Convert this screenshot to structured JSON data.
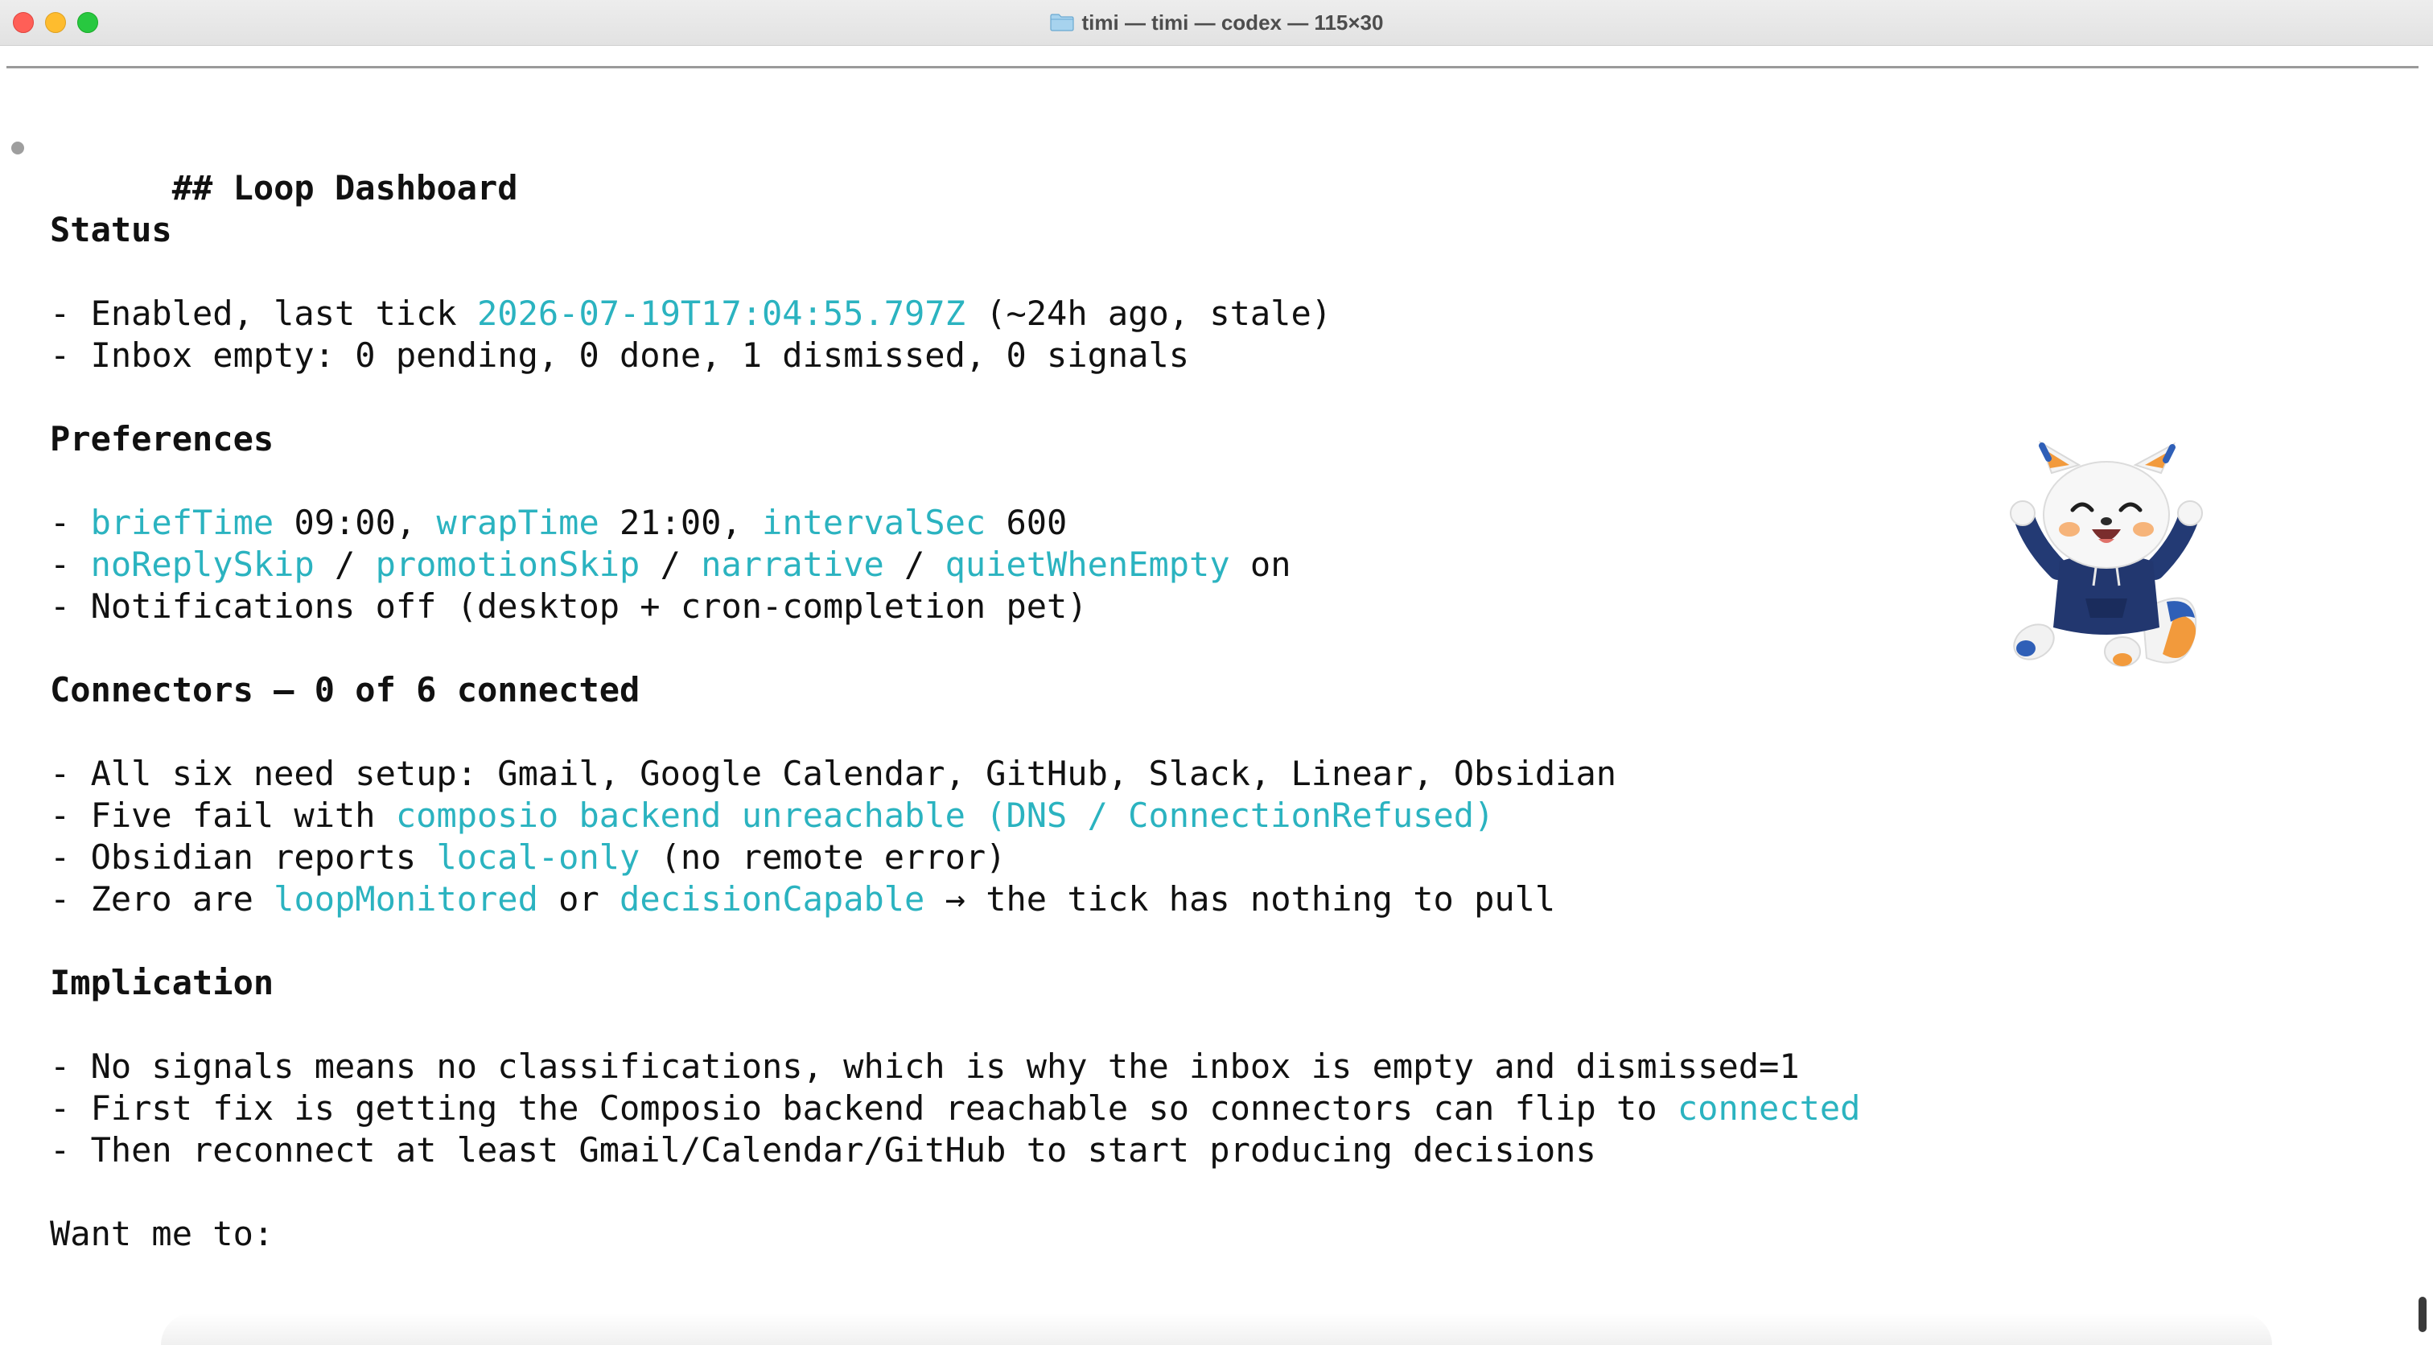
{
  "window": {
    "title": "timi — timi — codex — 115×30"
  },
  "dashboard": {
    "heading": "## Loop Dashboard",
    "status": {
      "heading": "Status",
      "line1": {
        "prefix": "- Enabled, last tick ",
        "timestamp": "2026-07-19T17:04:55.797Z",
        "suffix": " (~24h ago, stale)"
      },
      "line2": "- Inbox empty: 0 pending, 0 done, 1 dismissed, 0 signals"
    },
    "preferences": {
      "heading": "Preferences",
      "line1": {
        "dash": "- ",
        "k1": "briefTime",
        "v1": " 09:00, ",
        "k2": "wrapTime",
        "v2": " 21:00, ",
        "k3": "intervalSec",
        "v3": " 600"
      },
      "line2": {
        "dash": "- ",
        "k1": "noReplySkip",
        "s1": " / ",
        "k2": "promotionSkip",
        "s2": " / ",
        "k3": "narrative",
        "s3": " / ",
        "k4": "quietWhenEmpty",
        "tail": " on"
      },
      "line3": "- Notifications off (desktop + cron-completion pet)"
    },
    "connectors": {
      "heading": "Connectors — 0 of 6 connected",
      "line1": "- All six need setup: Gmail, Google Calendar, GitHub, Slack, Linear, Obsidian",
      "line2": {
        "prefix": "- Five fail with ",
        "hl": "composio backend unreachable (DNS / ConnectionRefused)"
      },
      "line3": {
        "prefix": "- Obsidian reports ",
        "hl": "local-only",
        "suffix": " (no remote error)"
      },
      "line4": {
        "prefix": "- Zero are ",
        "hl1": "loopMonitored",
        "mid": " or ",
        "hl2": "decisionCapable",
        "suffix": " → the tick has nothing to pull"
      }
    },
    "implication": {
      "heading": "Implication",
      "line1": "- No signals means no classifications, which is why the inbox is empty and dismissed=1",
      "line2": {
        "prefix": "- First fix is getting the Composio backend reachable so connectors can flip to ",
        "hl": "connected"
      },
      "line3": "- Then reconnect at least Gmail/Calendar/GitHub to start producing decisions"
    },
    "prompt": "Want me to:"
  },
  "colors": {
    "highlight": "#2bb3c0",
    "text": "#111111"
  },
  "icons": {
    "mascot": "fox-mascot-icon",
    "folder": "folder-icon"
  }
}
